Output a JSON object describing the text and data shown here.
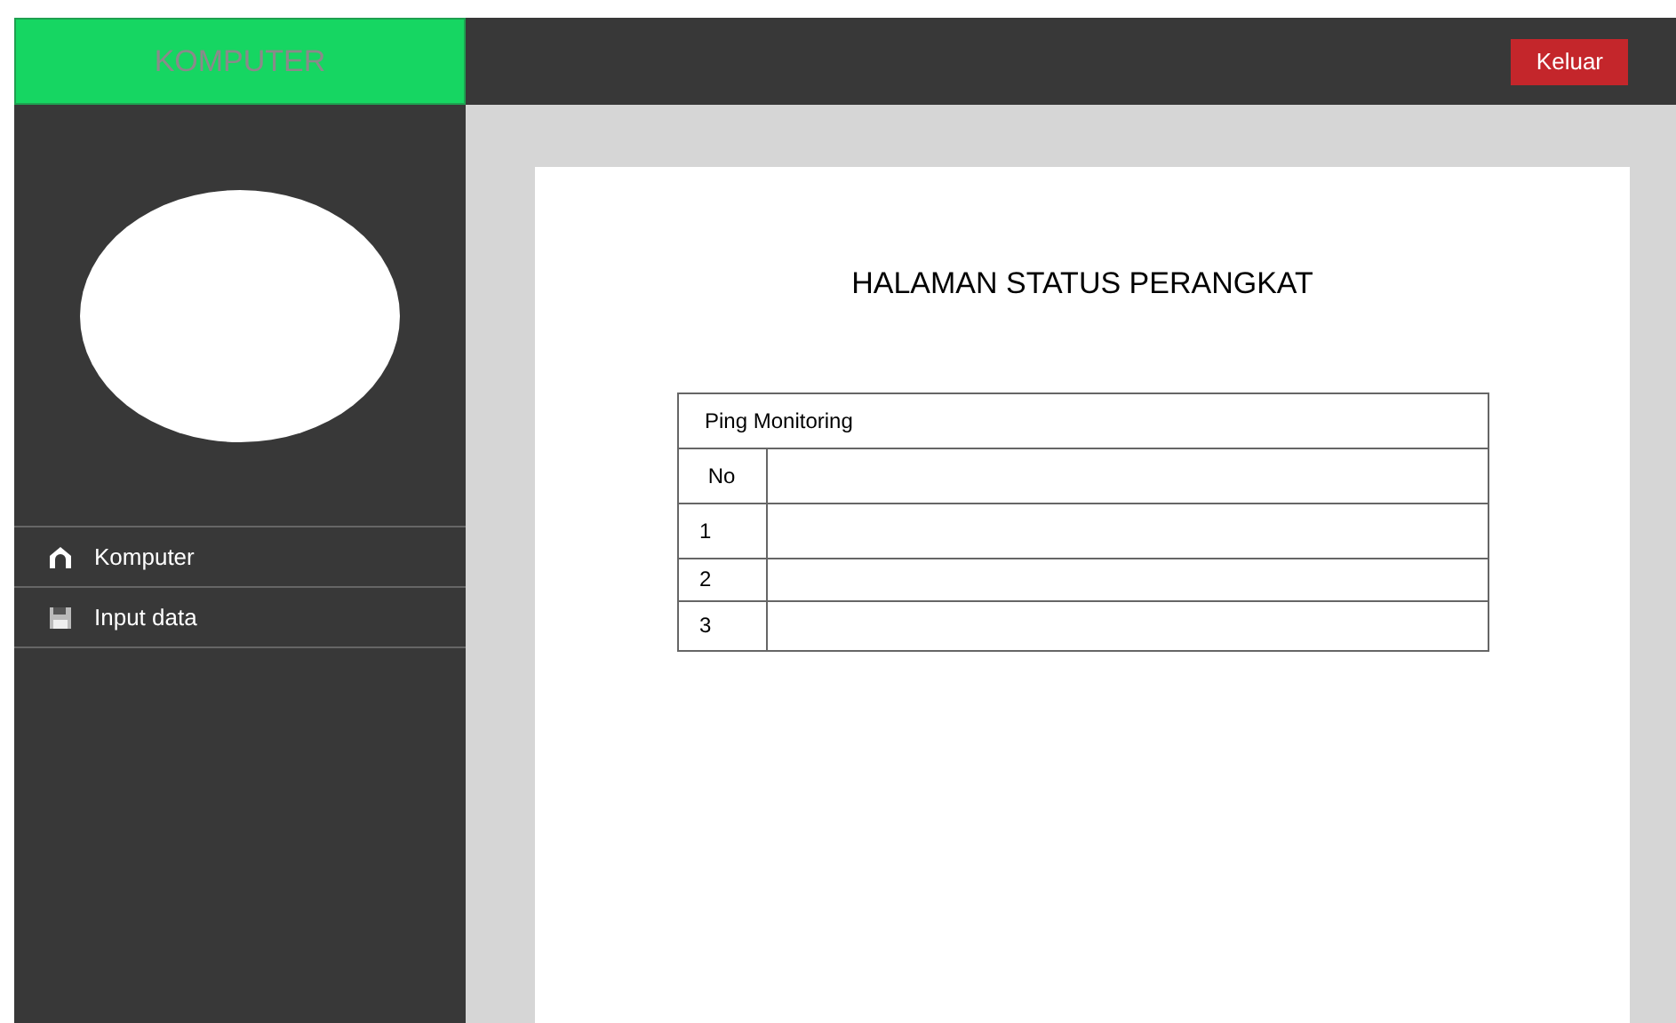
{
  "brand": "KOMPUTER",
  "header": {
    "logout_button": "Keluar"
  },
  "sidebar": {
    "items": [
      {
        "label": "Komputer",
        "kind": "home"
      },
      {
        "label": "Input data",
        "kind": "save"
      }
    ]
  },
  "page": {
    "title": "HALAMAN STATUS PERANGKAT",
    "table": {
      "caption": "Ping Monitoring",
      "columns": [
        "No"
      ],
      "rows": [
        [
          "1"
        ],
        [
          "2"
        ],
        [
          "3"
        ]
      ]
    }
  }
}
